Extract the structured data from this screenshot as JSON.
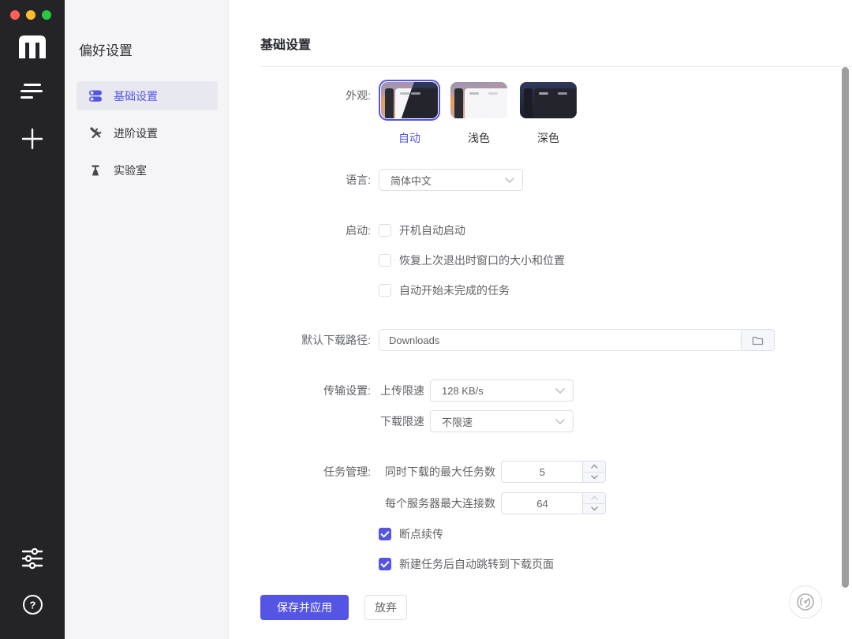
{
  "window": {
    "traffic_lights": [
      {
        "name": "close",
        "color": "#ff5f57"
      },
      {
        "name": "minimize",
        "color": "#febc2e"
      },
      {
        "name": "zoom",
        "color": "#28c840"
      }
    ]
  },
  "app_sidebar": {
    "logo": "m",
    "nav": [
      {
        "icon": "task-list-icon"
      },
      {
        "icon": "add-task-icon"
      }
    ],
    "bottom_nav": [
      {
        "icon": "preferences-sliders-icon"
      },
      {
        "icon": "help-icon"
      }
    ]
  },
  "prefs_sidebar": {
    "title": "偏好设置",
    "items": [
      {
        "label": "基础设置",
        "icon": "toggles-icon",
        "active": true
      },
      {
        "label": "进阶设置",
        "icon": "tools-icon",
        "active": false
      },
      {
        "label": "实验室",
        "icon": "lab-icon",
        "active": false
      }
    ]
  },
  "content": {
    "title": "基础设置",
    "appearance": {
      "label": "外观:",
      "options": [
        {
          "label": "自动",
          "selected": true
        },
        {
          "label": "浅色",
          "selected": false
        },
        {
          "label": "深色",
          "selected": false
        }
      ]
    },
    "language": {
      "label": "语言:",
      "value": "简体中文"
    },
    "startup": {
      "label": "启动:",
      "options": [
        {
          "label": "开机自动启动",
          "checked": false
        },
        {
          "label": "恢复上次退出时窗口的大小和位置",
          "checked": false
        },
        {
          "label": "自动开始未完成的任务",
          "checked": false
        }
      ]
    },
    "download_path": {
      "label": "默认下载路径:",
      "value": "Downloads"
    },
    "transfer": {
      "label": "传输设置:",
      "upload": {
        "label": "上传限速",
        "value": "128 KB/s"
      },
      "download": {
        "label": "下载限速",
        "value": "不限速"
      }
    },
    "task": {
      "label": "任务管理:",
      "max_tasks": {
        "label": "同时下载的最大任务数",
        "value": "5",
        "up_disabled": false
      },
      "max_connections": {
        "label": "每个服务器最大连接数",
        "value": "64",
        "up_disabled": true
      },
      "options": [
        {
          "label": "断点续传",
          "checked": true
        },
        {
          "label": "新建任务后自动跳转到下载页面",
          "checked": true
        }
      ]
    },
    "actions": {
      "save": "保存并应用",
      "discard": "放弃"
    }
  },
  "colors": {
    "accent": "#5455e5",
    "app_sidebar_bg": "#242428",
    "prefs_sidebar_bg": "#f5f5f7",
    "active_item_bg": "#e8e8f0"
  },
  "icons": {
    "chevron_down": "⌄",
    "check": "✓",
    "folder": "📁",
    "gauge": "speedometer",
    "question": "?",
    "plus": "+"
  }
}
